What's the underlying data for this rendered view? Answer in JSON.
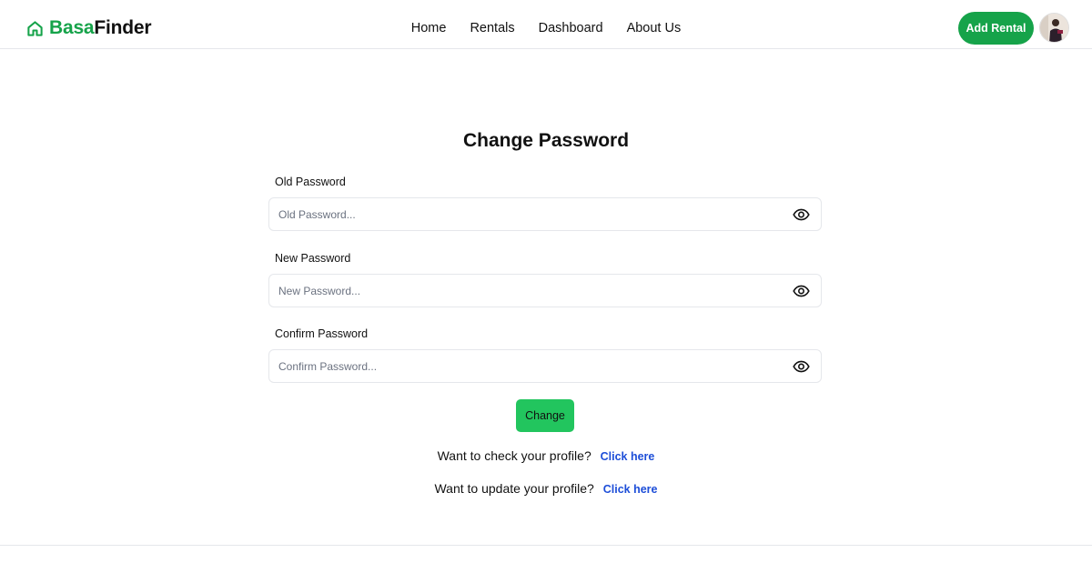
{
  "nav": {
    "brand_part1": "Basa",
    "brand_part2": "Finder",
    "links": [
      "Home",
      "Rentals",
      "Dashboard",
      "About Us"
    ],
    "cta_label": "Add Rental"
  },
  "form": {
    "title": "Change Password",
    "fields": [
      {
        "label": "Old Password",
        "placeholder": "Old Password..."
      },
      {
        "label": "New Password",
        "placeholder": "New Password..."
      },
      {
        "label": "Confirm Password",
        "placeholder": "Confirm Password..."
      }
    ],
    "submit_label": "Change"
  },
  "links": [
    {
      "prompt": "Want to check your profile?",
      "link_text": "Click here"
    },
    {
      "prompt": "Want to update your profile?",
      "link_text": "Click here"
    }
  ],
  "colors": {
    "brand_green": "#16a34a",
    "button_green": "#22c55e",
    "link_blue": "#1d4ed8"
  },
  "icons": {
    "brand": "home-icon",
    "field_toggle": "eye-icon"
  }
}
